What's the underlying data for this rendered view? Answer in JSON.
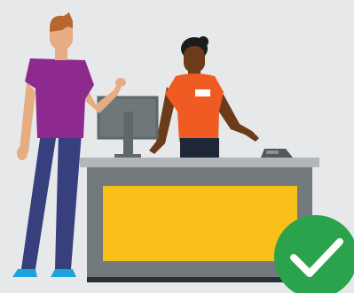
{
  "colors": {
    "background": "#e6e8ea",
    "customer_shirt": "#8e2a8e",
    "customer_skin": "#e6ac82",
    "customer_hair": "#b8662f",
    "customer_pants": "#37407d",
    "customer_shoes": "#1aa3dc",
    "clerk_shirt": "#f05a23",
    "clerk_skin": "#6b3b1b",
    "clerk_hair": "#1c1c1c",
    "clerk_pants": "#1e2738",
    "name_tag": "#ffffff",
    "counter_top": "#b3b6b9",
    "counter_body": "#737a7d",
    "counter_panel": "#fbbf1a",
    "counter_base": "#2b3033",
    "monitor": "#5f686b",
    "monitor_screen": "#6e777a",
    "card_reader": "#4f585b",
    "check_circle": "#2ba24c",
    "check_mark": "#ffffff"
  },
  "scene": {
    "subject": "customer-at-checkout-counter",
    "status_icon": "check-circle-icon"
  }
}
